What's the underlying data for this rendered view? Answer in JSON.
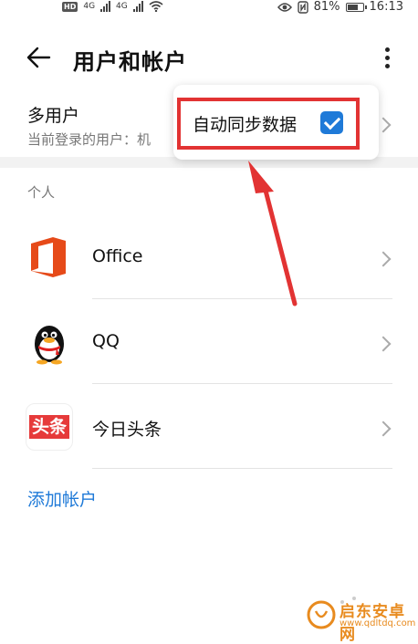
{
  "status_bar": {
    "hd": "HD",
    "net1": "4G",
    "net2": "4G",
    "battery": "81%",
    "battery_level": 0.81,
    "time": "16:13"
  },
  "header": {
    "title": "用户和帐户"
  },
  "multi_user": {
    "title": "多用户",
    "subtitle": "当前登录的用户：机"
  },
  "popup": {
    "label": "自动同步数据",
    "checked": true
  },
  "section": {
    "label": "个人"
  },
  "accounts": [
    {
      "label": "Office",
      "icon": "office-icon"
    },
    {
      "label": "QQ",
      "icon": "qq-penguin-icon"
    },
    {
      "label": "今日头条",
      "icon": "toutiao-icon",
      "logo_text": "头条"
    }
  ],
  "add_account": {
    "label": "添加帐户"
  },
  "watermark": {
    "name": "启东安卓网",
    "url": "www.qdltdq.com"
  },
  "colors": {
    "accent": "#1f7ad8",
    "highlight": "#e23333"
  }
}
